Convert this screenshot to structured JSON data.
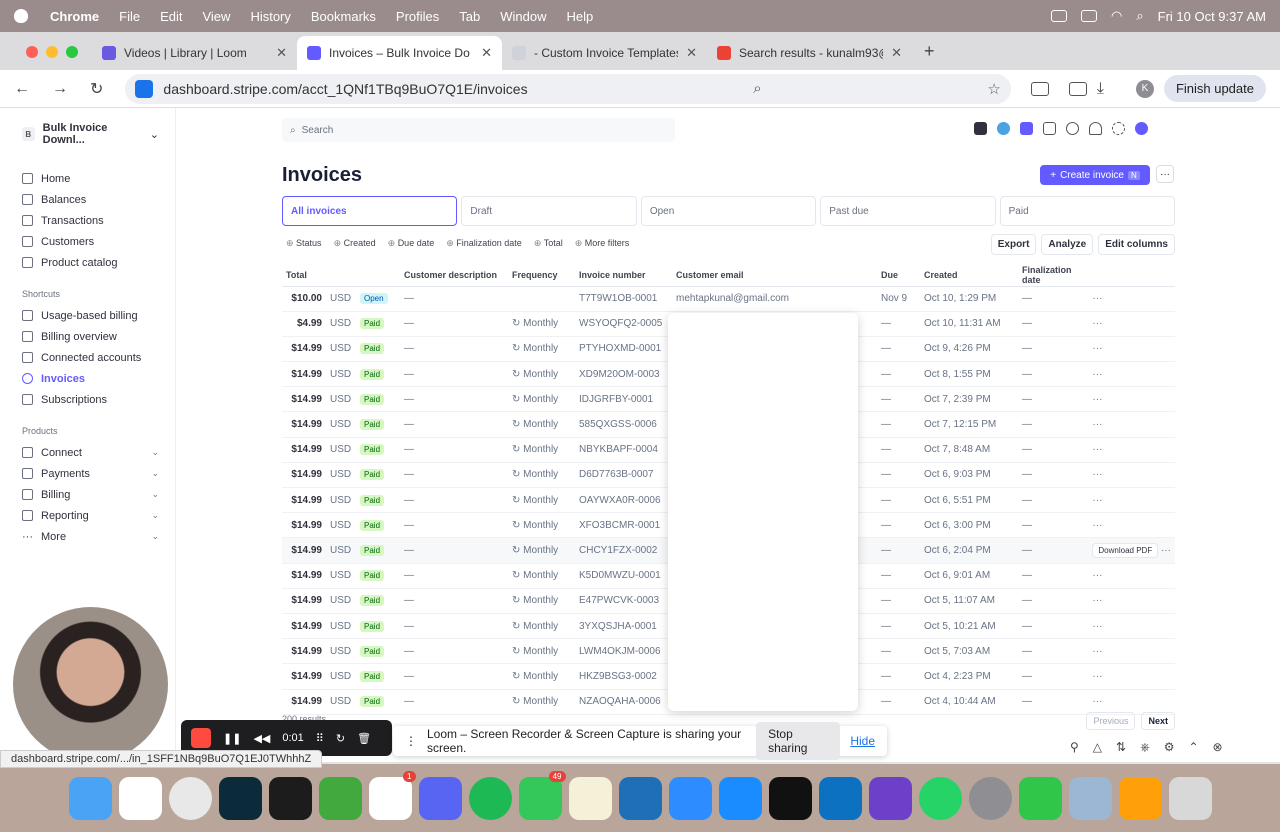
{
  "menubar": {
    "app": "Chrome",
    "items": [
      "File",
      "Edit",
      "View",
      "History",
      "Bookmarks",
      "Profiles",
      "Tab",
      "Window",
      "Help"
    ],
    "datetime": "Fri 10 Oct  9:37 AM"
  },
  "tabs": [
    {
      "title": "Videos | Library | Loom",
      "active": false,
      "color": "#6a5ae0"
    },
    {
      "title": "Invoices – Bulk Invoice Do",
      "active": true,
      "color": "#635bff"
    },
    {
      "title": "- Custom Invoice Templates",
      "active": false,
      "color": "#cfd2d8"
    },
    {
      "title": "Search results - kunalm93@g",
      "active": false,
      "color": "#ea4335"
    }
  ],
  "address": {
    "url": "dashboard.stripe.com/acct_1QNf1TBq9BuO7Q1E/invoices",
    "avatar": "K",
    "finish": "Finish update"
  },
  "sidebar": {
    "account": "Bulk Invoice Downl...",
    "account_initial": "B",
    "main": [
      {
        "label": "Home"
      },
      {
        "label": "Balances"
      },
      {
        "label": "Transactions"
      },
      {
        "label": "Customers"
      },
      {
        "label": "Product catalog"
      }
    ],
    "shortcuts_title": "Shortcuts",
    "shortcuts": [
      {
        "label": "Usage-based billing"
      },
      {
        "label": "Billing overview"
      },
      {
        "label": "Connected accounts"
      },
      {
        "label": "Invoices",
        "active": true
      },
      {
        "label": "Subscriptions"
      }
    ],
    "products_title": "Products",
    "products": [
      {
        "label": "Connect"
      },
      {
        "label": "Payments"
      },
      {
        "label": "Billing"
      },
      {
        "label": "Reporting"
      },
      {
        "label": "More"
      }
    ]
  },
  "main": {
    "search_placeholder": "Search",
    "title": "Invoices",
    "create": "Create invoice",
    "create_kbd": "N",
    "status_tabs": [
      "All invoices",
      "Draft",
      "Open",
      "Past due",
      "Paid"
    ],
    "filters": [
      "Status",
      "Created",
      "Due date",
      "Finalization date",
      "Total",
      "More filters"
    ],
    "actions": [
      "Export",
      "Analyze",
      "Edit columns"
    ],
    "columns": [
      "Total",
      "",
      "",
      "Customer description",
      "Frequency",
      "Invoice number",
      "Customer email",
      "Due",
      "Created",
      "Finalization date"
    ],
    "rows": [
      {
        "total": "$10.00",
        "cur": "USD",
        "status": "Open",
        "desc": "—",
        "freq": "",
        "num": "T7T9W1OB-0001",
        "email": "mehtapkunal@gmail.com",
        "due": "Nov 9",
        "created": "Oct 10, 1:29 PM",
        "fin": "—"
      },
      {
        "total": "$4.99",
        "cur": "USD",
        "status": "Paid",
        "desc": "—",
        "freq": "Monthly",
        "num": "WSYOQFQ2-0005",
        "email": "",
        "due": "—",
        "created": "Oct 10, 11:31 AM",
        "fin": "—"
      },
      {
        "total": "$14.99",
        "cur": "USD",
        "status": "Paid",
        "desc": "—",
        "freq": "Monthly",
        "num": "PTYHOXMD-0001",
        "email": "",
        "due": "—",
        "created": "Oct 9, 4:26 PM",
        "fin": "—"
      },
      {
        "total": "$14.99",
        "cur": "USD",
        "status": "Paid",
        "desc": "—",
        "freq": "Monthly",
        "num": "XD9M20OM-0003",
        "email": "",
        "due": "—",
        "created": "Oct 8, 1:55 PM",
        "fin": "—"
      },
      {
        "total": "$14.99",
        "cur": "USD",
        "status": "Paid",
        "desc": "—",
        "freq": "Monthly",
        "num": "IDJGRFBY-0001",
        "email": "",
        "due": "—",
        "created": "Oct 7, 2:39 PM",
        "fin": "—"
      },
      {
        "total": "$14.99",
        "cur": "USD",
        "status": "Paid",
        "desc": "—",
        "freq": "Monthly",
        "num": "585QXGSS-0006",
        "email": "",
        "due": "—",
        "created": "Oct 7, 12:15 PM",
        "fin": "—"
      },
      {
        "total": "$14.99",
        "cur": "USD",
        "status": "Paid",
        "desc": "—",
        "freq": "Monthly",
        "num": "NBYKBAPF-0004",
        "email": "",
        "due": "—",
        "created": "Oct 7, 8:48 AM",
        "fin": "—"
      },
      {
        "total": "$14.99",
        "cur": "USD",
        "status": "Paid",
        "desc": "—",
        "freq": "Monthly",
        "num": "D6D7763B-0007",
        "email": "",
        "due": "—",
        "created": "Oct 6, 9:03 PM",
        "fin": "—"
      },
      {
        "total": "$14.99",
        "cur": "USD",
        "status": "Paid",
        "desc": "—",
        "freq": "Monthly",
        "num": "OAYWXA0R-0006",
        "email": "",
        "due": "—",
        "created": "Oct 6, 5:51 PM",
        "fin": "—"
      },
      {
        "total": "$14.99",
        "cur": "USD",
        "status": "Paid",
        "desc": "—",
        "freq": "Monthly",
        "num": "XFO3BCMR-0001",
        "email": "",
        "due": "—",
        "created": "Oct 6, 3:00 PM",
        "fin": "—"
      },
      {
        "total": "$14.99",
        "cur": "USD",
        "status": "Paid",
        "desc": "—",
        "freq": "Monthly",
        "num": "CHCY1FZX-0002",
        "email": "",
        "due": "—",
        "created": "Oct 6, 2:04 PM",
        "fin": "—",
        "hover": true
      },
      {
        "total": "$14.99",
        "cur": "USD",
        "status": "Paid",
        "desc": "—",
        "freq": "Monthly",
        "num": "K5D0MWZU-0001",
        "email": "",
        "due": "—",
        "created": "Oct 6, 9:01 AM",
        "fin": "—"
      },
      {
        "total": "$14.99",
        "cur": "USD",
        "status": "Paid",
        "desc": "—",
        "freq": "Monthly",
        "num": "E47PWCVK-0003",
        "email": "",
        "due": "—",
        "created": "Oct 5, 11:07 AM",
        "fin": "—"
      },
      {
        "total": "$14.99",
        "cur": "USD",
        "status": "Paid",
        "desc": "—",
        "freq": "Monthly",
        "num": "3YXQSJHA-0001",
        "email": "",
        "due": "—",
        "created": "Oct 5, 10:21 AM",
        "fin": "—"
      },
      {
        "total": "$14.99",
        "cur": "USD",
        "status": "Paid",
        "desc": "—",
        "freq": "Monthly",
        "num": "LWM4OKJM-0006",
        "email": "",
        "due": "—",
        "created": "Oct 5, 7:03 AM",
        "fin": "—"
      },
      {
        "total": "$14.99",
        "cur": "USD",
        "status": "Paid",
        "desc": "—",
        "freq": "Monthly",
        "num": "HKZ9BSG3-0002",
        "email": "",
        "due": "—",
        "created": "Oct 4, 2:23 PM",
        "fin": "—"
      },
      {
        "total": "$14.99",
        "cur": "USD",
        "status": "Paid",
        "desc": "—",
        "freq": "Monthly",
        "num": "NZAOQAHA-0006",
        "email": "",
        "due": "—",
        "created": "Oct 4, 10:44 AM",
        "fin": "—"
      }
    ],
    "download_pdf": "Download PDF",
    "results": "200 results",
    "prev": "Previous",
    "next": "Next"
  },
  "recorder": {
    "time": "0:01"
  },
  "sharing": {
    "message": "Loom – Screen Recorder & Screen Capture is sharing your screen.",
    "stop": "Stop sharing",
    "hide": "Hide"
  },
  "statusbar": "dashboard.stripe.com/.../in_1SFF1NBq9BuO7Q1EJ0TWhhhZ",
  "dock": {
    "badges": {
      "slack": "1",
      "messages": "49"
    }
  }
}
